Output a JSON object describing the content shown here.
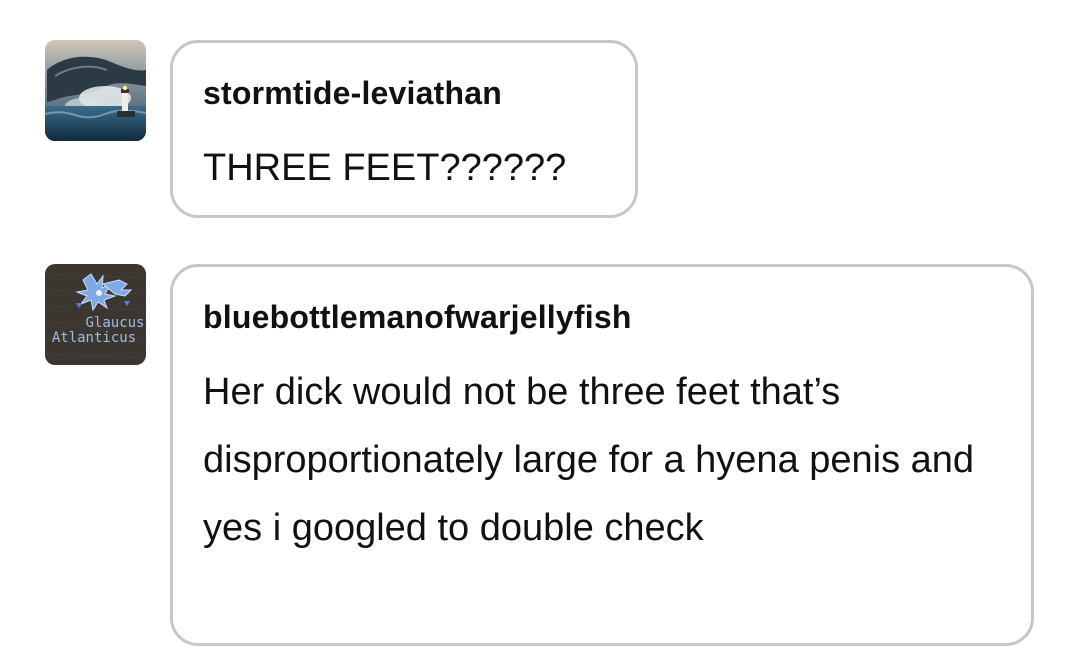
{
  "replies": [
    {
      "username": "stormtide-leviathan",
      "message": "THREE FEET??????",
      "avatar": {
        "icon": "sea-monster-lighthouse-avatar-icon"
      }
    },
    {
      "username": "bluebottlemanofwarjellyfish",
      "message": "Her dick would not be three feet that’s disproportionately large for a hyena penis and yes i googled to double check",
      "avatar": {
        "icon": "blue-sea-slug-embroidery-avatar-icon",
        "caption_line1": "Glaucus",
        "caption_line2": "Atlanticus"
      }
    }
  ],
  "colors": {
    "bubble_border": "#c7c7c7",
    "text": "#111111",
    "background": "#ffffff"
  }
}
